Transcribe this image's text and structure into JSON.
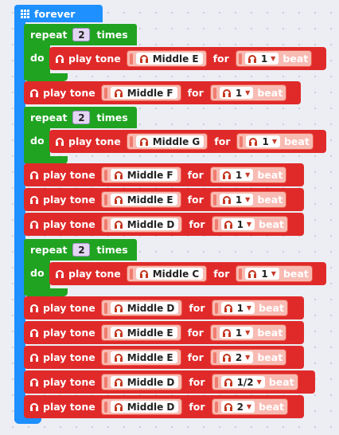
{
  "forever": {
    "label": "forever"
  },
  "repeat": {
    "label": "repeat",
    "times_label": "times",
    "do_label": "do"
  },
  "tone_block": {
    "play_label": "play tone",
    "for_label": "for",
    "beat_label": "beat",
    "dropdown_arrow": "▼"
  },
  "repeats": [
    {
      "count": "2"
    },
    {
      "count": "2"
    },
    {
      "count": "2"
    }
  ],
  "tones": [
    {
      "note": "Middle E",
      "beats": "1"
    },
    {
      "note": "Middle F",
      "beats": "1"
    },
    {
      "note": "Middle G",
      "beats": "1"
    },
    {
      "note": "Middle F",
      "beats": "1"
    },
    {
      "note": "Middle E",
      "beats": "1"
    },
    {
      "note": "Middle D",
      "beats": "1"
    },
    {
      "note": "Middle C",
      "beats": "1"
    },
    {
      "note": "Middle D",
      "beats": "1"
    },
    {
      "note": "Middle E",
      "beats": "1"
    },
    {
      "note": "Middle E",
      "beats": "2"
    },
    {
      "note": "Middle D",
      "beats": "1/2"
    },
    {
      "note": "Middle D",
      "beats": "2"
    }
  ],
  "colors": {
    "forever": "#1e90ff",
    "repeat": "#20a321",
    "tone": "#e02a2a",
    "background": "#eceef4"
  }
}
